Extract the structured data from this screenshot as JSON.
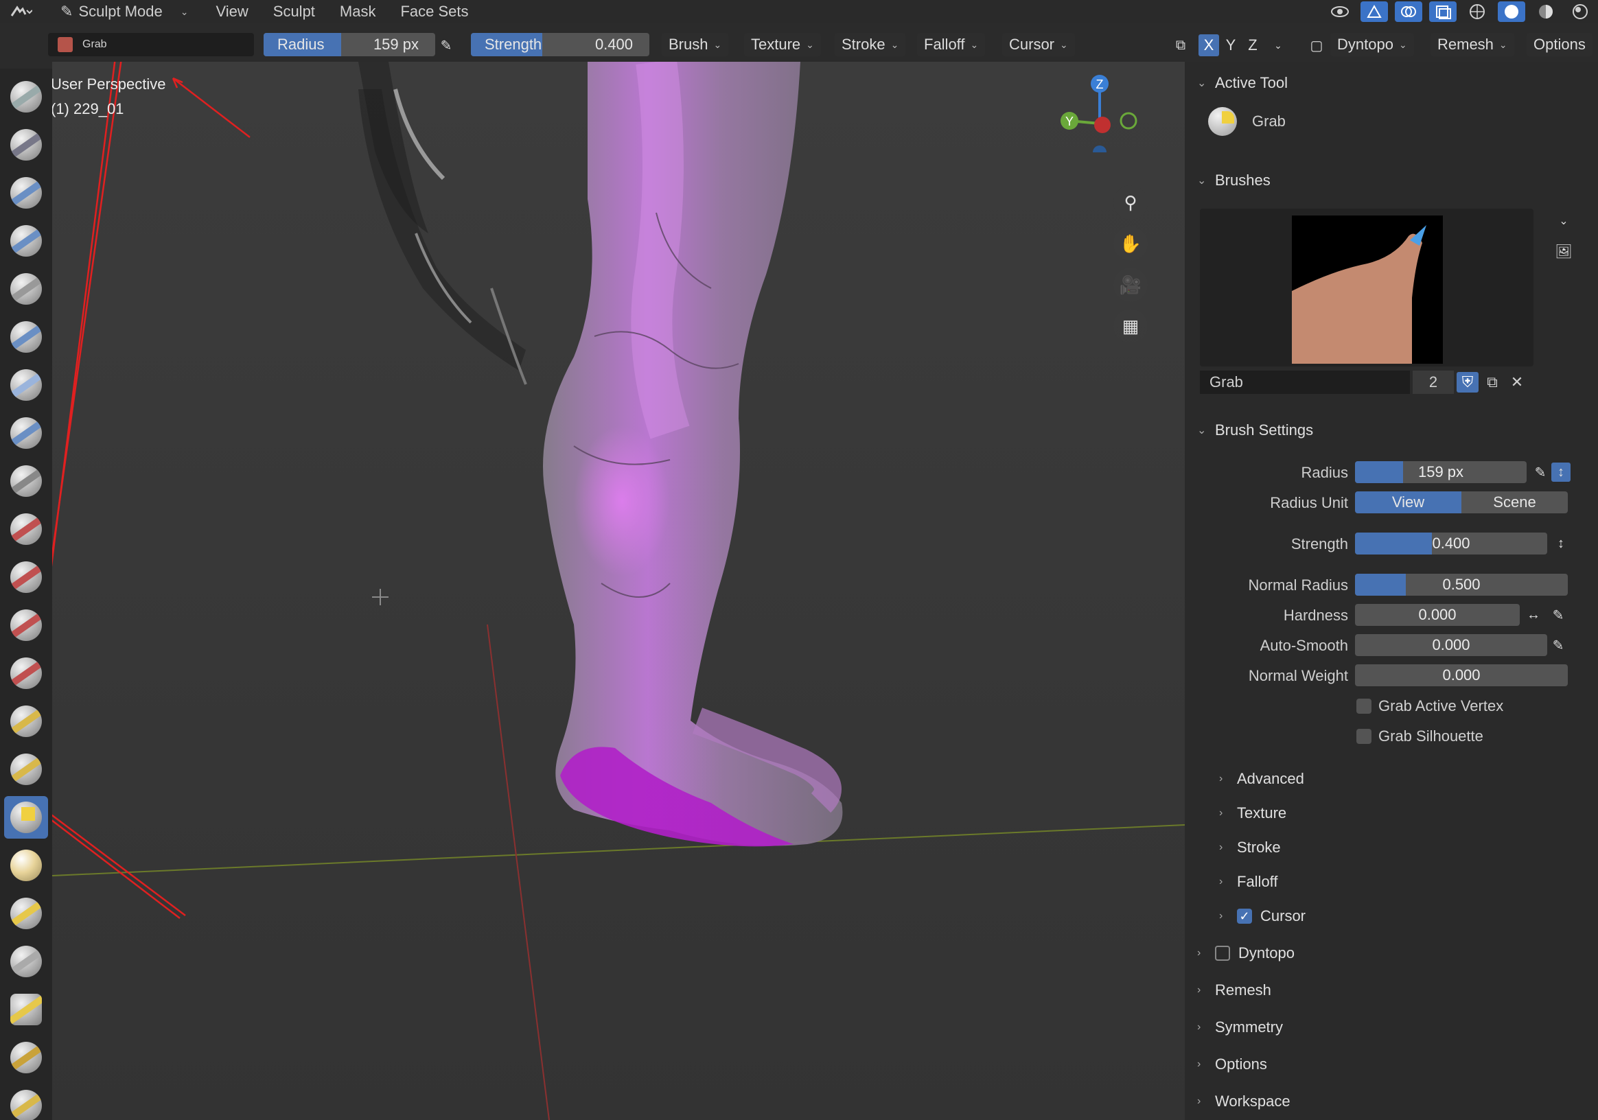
{
  "header": {
    "mode_label": "Sculpt Mode",
    "menus": [
      "View",
      "Sculpt",
      "Mask",
      "Face Sets"
    ]
  },
  "toolbar": {
    "brush_name": "Grab",
    "radius_label": "Radius",
    "radius_value": "159 px",
    "radius_fraction": 0.45,
    "strength_label": "Strength",
    "strength_value": "0.400",
    "strength_fraction": 0.4,
    "dropdowns": [
      "Brush",
      "Texture",
      "Stroke",
      "Falloff",
      "Cursor"
    ],
    "axis": [
      "X",
      "Y",
      "Z"
    ],
    "dyntopo": "Dyntopo",
    "remesh": "Remesh",
    "options": "Options"
  },
  "viewport": {
    "perspective": "User Perspective",
    "object": "(1) 229_01",
    "gizmo": {
      "z": "Z",
      "y": "Y"
    }
  },
  "panel": {
    "active_tool_title": "Active Tool",
    "active_tool_name": "Grab",
    "brushes_title": "Brushes",
    "brush_name": "Grab",
    "brush_users": "2",
    "brush_settings_title": "Brush Settings",
    "radius_label": "Radius",
    "radius_value": "159 px",
    "radius_unit_label": "Radius Unit",
    "radius_unit_view": "View",
    "radius_unit_scene": "Scene",
    "strength_label": "Strength",
    "strength_value": "0.400",
    "normal_radius_label": "Normal Radius",
    "normal_radius_value": "0.500",
    "hardness_label": "Hardness",
    "hardness_value": "0.000",
    "auto_smooth_label": "Auto-Smooth",
    "auto_smooth_value": "0.000",
    "normal_weight_label": "Normal Weight",
    "normal_weight_value": "0.000",
    "grab_active_vertex": "Grab Active Vertex",
    "grab_silhouette": "Grab Silhouette",
    "subsections": [
      "Advanced",
      "Texture",
      "Stroke",
      "Falloff",
      "Cursor"
    ],
    "sections": [
      "Dyntopo",
      "Remesh",
      "Symmetry",
      "Options",
      "Workspace"
    ]
  },
  "colors": {
    "accent": "#4772b3",
    "mask_magenta": "#c060e0"
  }
}
